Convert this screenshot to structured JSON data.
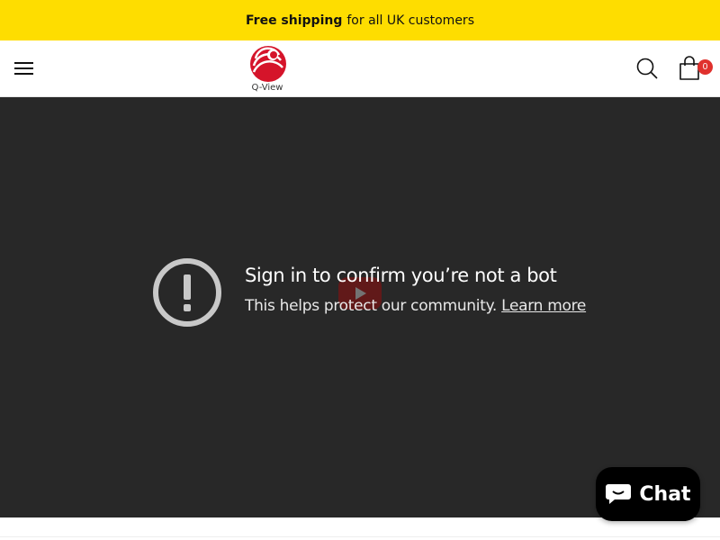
{
  "announcement": {
    "bold_text": "Free shipping",
    "text": "for all UK customers"
  },
  "header": {
    "logo_text": "Q-View",
    "cart_count": "0"
  },
  "video": {
    "message_title": "Sign in to confirm you’re not a bot",
    "message_body": "This helps protect our community.",
    "learn_more": "Learn more"
  },
  "chat": {
    "label": "Chat"
  },
  "colors": {
    "announcement_bg": "#fedd00",
    "video_bg": "#282828",
    "badge": "#e0312d",
    "chat_bg": "#000000"
  },
  "icons": [
    "menu-icon",
    "q-view-logo",
    "search-icon",
    "cart-icon",
    "warning-icon",
    "play-icon",
    "chat-bubble-icon"
  ]
}
